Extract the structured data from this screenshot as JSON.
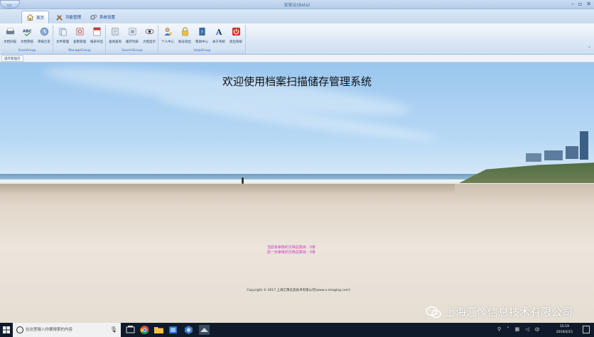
{
  "window": {
    "title": "安家云(Beta)",
    "controls": [
      "minimize-icon",
      "restore-icon",
      "close-icon"
    ]
  },
  "tabs": [
    {
      "label": "首页",
      "icon": "home-icon",
      "active": true
    },
    {
      "label": "功能管理",
      "icon": "tools-icon",
      "active": false
    },
    {
      "label": "系统设置",
      "icon": "settings-icon",
      "active": false
    }
  ],
  "ribbon": {
    "groups": [
      {
        "label": "ScanGroup",
        "buttons": [
          {
            "label": "文档扫描",
            "icon": "scanner-icon"
          },
          {
            "label": "文档审核",
            "icon": "spellcheck-icon"
          },
          {
            "label": "审核历史",
            "icon": "history-icon"
          }
        ]
      },
      {
        "label": "ManageGroup",
        "buttons": [
          {
            "label": "文件管理",
            "icon": "file-manage-icon"
          },
          {
            "label": "查看管理",
            "icon": "view-manage-icon"
          },
          {
            "label": "报表导出",
            "icon": "export-icon"
          }
        ]
      },
      {
        "label": "SearchGroup",
        "buttons": [
          {
            "label": "查阅查询",
            "icon": "search-doc-icon"
          },
          {
            "label": "缓存列表",
            "icon": "cache-list-icon"
          },
          {
            "label": "大图显示",
            "icon": "eye-icon"
          }
        ]
      },
      {
        "label": "HelpGroup",
        "buttons": [
          {
            "label": "个人中心",
            "icon": "user-icon"
          },
          {
            "label": "账号退出",
            "icon": "lock-icon"
          },
          {
            "label": "帮助中心",
            "icon": "help-book-icon"
          },
          {
            "label": "关于系统",
            "icon": "about-icon"
          },
          {
            "label": "退出系统",
            "icon": "power-icon"
          }
        ]
      }
    ],
    "collapse_icon": "caret-up-icon"
  },
  "doc_tab": {
    "label": "操作管理页"
  },
  "main": {
    "title": "欢迎使用档案扫描储存管理系统",
    "notice_lines": [
      "当前未审核的文档总数目：0条",
      "前一天审核的文档总数目：0条"
    ],
    "copyright": "Copyright © 2017 上海汇像信息技术有限公司[www.a-imaging.com]"
  },
  "watermark": {
    "text": "上海汇像信息技术有限公司",
    "icon": "wechat-icon"
  },
  "taskbar": {
    "search_placeholder": "在这里输入你要搜索的内容",
    "time": "15:19",
    "date": "2019/2/15",
    "apps": [
      "task-view-icon",
      "chrome-icon",
      "file-explorer-icon",
      "app-icon",
      "app-icon-2",
      "app-icon-3"
    ]
  },
  "colors": {
    "ribbon_accent": "#15428b",
    "notice": "#d630c6",
    "taskbar": "#101a2a"
  }
}
